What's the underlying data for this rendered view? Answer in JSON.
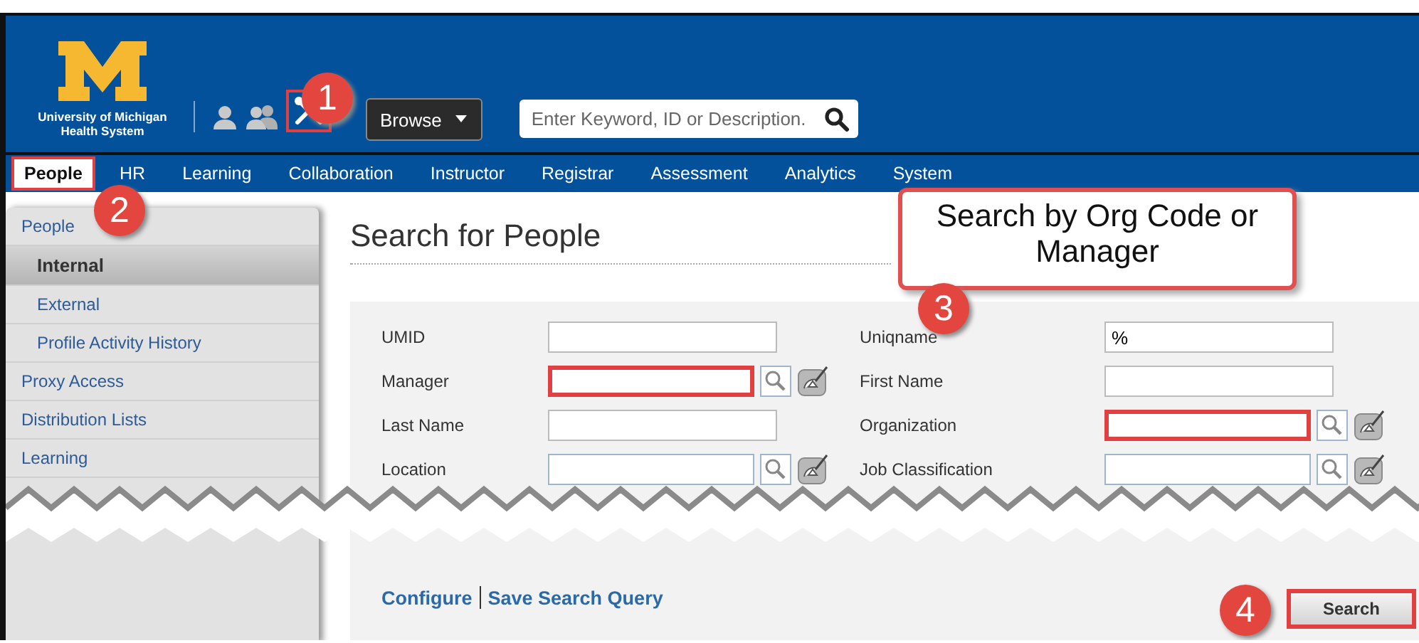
{
  "header": {
    "logo_lines": [
      "University of Michigan",
      "Health System"
    ],
    "tools_highlighted": true,
    "browse_button": "Browse",
    "search": {
      "placeholder": "Enter Keyword, ID or Description."
    }
  },
  "nav": [
    {
      "label": "People",
      "selected": true,
      "highlighted": true
    },
    {
      "label": "HR",
      "selected": false,
      "highlighted": false
    },
    {
      "label": "Learning",
      "selected": false,
      "highlighted": false
    },
    {
      "label": "Collaboration",
      "selected": false,
      "highlighted": false
    },
    {
      "label": "Instructor",
      "selected": false,
      "highlighted": false
    },
    {
      "label": "Registrar",
      "selected": false,
      "highlighted": false
    },
    {
      "label": "Assessment",
      "selected": false,
      "highlighted": false
    },
    {
      "label": "Analytics",
      "selected": false,
      "highlighted": false
    },
    {
      "label": "System",
      "selected": false,
      "highlighted": false
    }
  ],
  "sidebar": [
    {
      "label": "People",
      "selected": false,
      "children": [
        {
          "label": "Internal",
          "selected": true
        },
        {
          "label": "External",
          "selected": false
        },
        {
          "label": "Profile Activity History",
          "selected": false
        }
      ]
    },
    {
      "label": "Proxy Access",
      "selected": false
    },
    {
      "label": "Distribution Lists",
      "selected": false
    },
    {
      "label": "Learning",
      "selected": false
    }
  ],
  "page_title": "Search for People",
  "callout": {
    "text": "Search by Org Code or Manager"
  },
  "form": {
    "fields": [
      {
        "label": "UMID",
        "kind": "text",
        "highlighted": false
      },
      {
        "label": "Uniqname",
        "kind": "text",
        "value": "%",
        "highlighted": false
      },
      {
        "label": "Manager",
        "kind": "lookup",
        "highlighted": true
      },
      {
        "label": "First Name",
        "kind": "text",
        "highlighted": false
      },
      {
        "label": "Last Name",
        "kind": "text",
        "highlighted": false
      },
      {
        "label": "Organization",
        "kind": "lookup",
        "highlighted": true
      },
      {
        "label": "Location",
        "kind": "lookup",
        "highlighted": false
      },
      {
        "label": "Job Classification",
        "kind": "lookup",
        "highlighted": false
      }
    ],
    "links": [
      "Configure",
      "Save Search Query"
    ],
    "search_button": {
      "label": "Search",
      "highlighted": true
    }
  },
  "annotations": [
    {
      "number": "1"
    },
    {
      "number": "2"
    },
    {
      "number": "3"
    },
    {
      "number": "4"
    }
  ]
}
